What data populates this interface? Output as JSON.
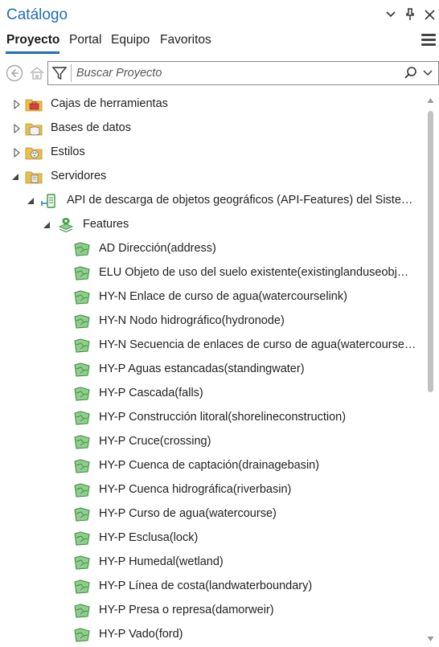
{
  "panel": {
    "title": "Catálogo",
    "tabs": [
      {
        "label": "Proyecto",
        "active": true
      },
      {
        "label": "Portal",
        "active": false
      },
      {
        "label": "Equipo",
        "active": false
      },
      {
        "label": "Favoritos",
        "active": false
      }
    ]
  },
  "search": {
    "placeholder": "Buscar Proyecto"
  },
  "tree": {
    "toolboxes": "Cajas de herramientas",
    "databases": "Bases de datos",
    "styles": "Estilos",
    "servers": "Servidores",
    "server_item": "API de descarga de objetos geográficos (API-Features) del Siste…",
    "features": "Features",
    "layers": [
      "AD Dirección(address)",
      "ELU Objeto de uso del suelo existente(existinglanduseobj…",
      "HY-N Enlace de curso de agua(watercourselink)",
      "HY-N Nodo hidrográfico(hydronode)",
      "HY-N Secuencia de enlaces de curso de agua(watercourse…",
      "HY-P Aguas estancadas(standingwater)",
      "HY-P Cascada(falls)",
      "HY-P Construcción litoral(shorelineconstruction)",
      "HY-P Cruce(crossing)",
      "HY-P Cuenca de captación(drainagebasin)",
      "HY-P Cuenca hidrográfica(riverbasin)",
      "HY-P Curso de agua(watercourse)",
      "HY-P Esclusa(lock)",
      "HY-P Humedal(wetland)",
      "HY-P Línea de costa(landwaterboundary)",
      "HY-P Presa o represa(damorweir)",
      "HY-P Vado(ford)"
    ]
  },
  "colors": {
    "accent": "#1f6fb5",
    "layer_icon_fill": "#8fce8f",
    "layer_icon_stroke": "#3f8f3f",
    "folder_yellow": "#e8c04a"
  }
}
